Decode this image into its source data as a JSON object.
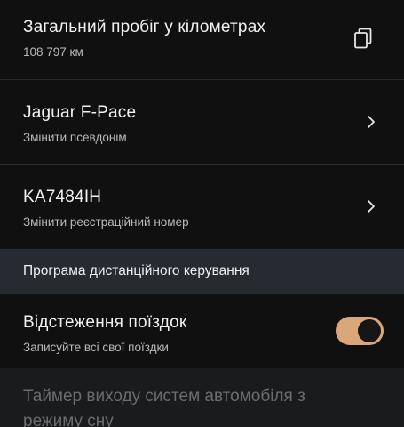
{
  "mileage": {
    "title": "Загальний пробіг у кілометрах",
    "value": "108 797 км",
    "action_icon": "copy-icon"
  },
  "vehicle_name": {
    "title": "Jaguar F-Pace",
    "subtitle": "Змінити псевдонім",
    "action_icon": "chevron-right-icon"
  },
  "registration": {
    "title": "KA7484IH",
    "subtitle": "Змінити реєстраційний номер",
    "action_icon": "chevron-right-icon"
  },
  "remote_program": {
    "header": "Програма дистанційного керування"
  },
  "trip_tracking": {
    "title": "Відстеження поїздок",
    "subtitle": "Записуйте всі свої поїздки",
    "enabled": true
  },
  "sleep_timer": {
    "title": "Таймер виходу систем автомобіля з режиму сну"
  },
  "colors": {
    "background": "#101010",
    "section_header": "#252b31",
    "toggle_on": "#d9a77a",
    "divider": "#2a2c2f"
  }
}
